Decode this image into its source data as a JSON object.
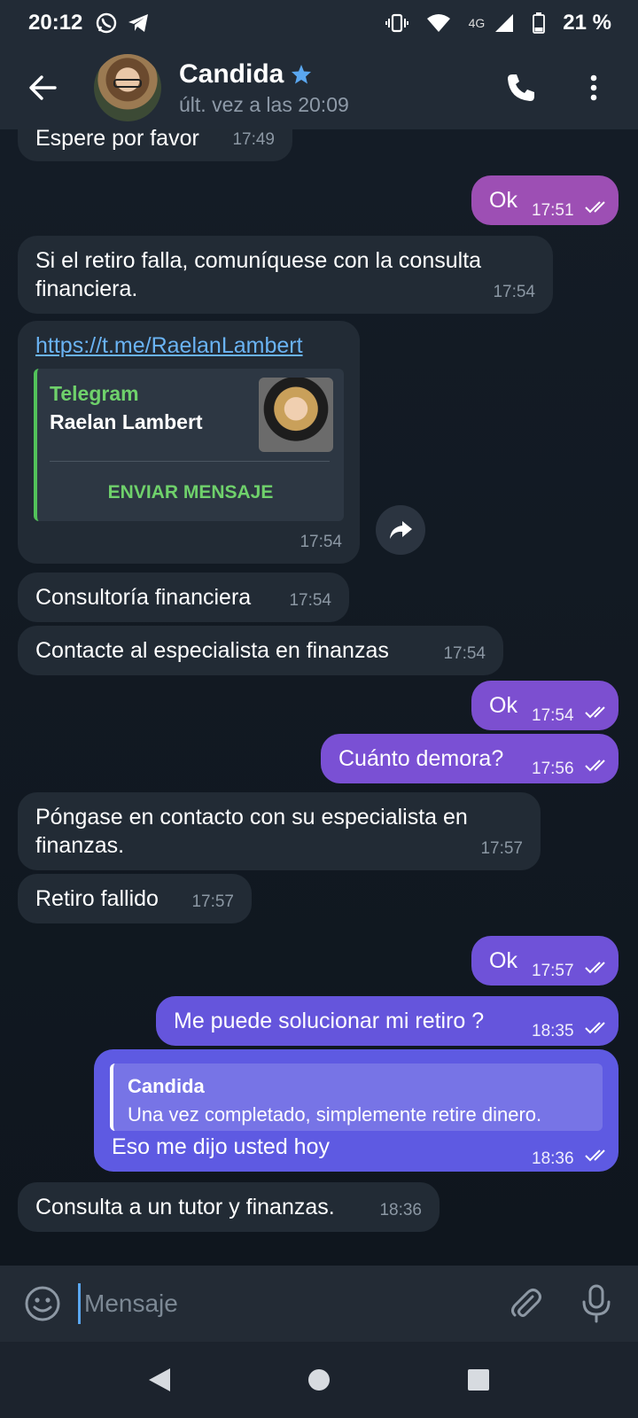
{
  "status_bar": {
    "time": "20:12",
    "network": "4G",
    "battery": "21 %"
  },
  "header": {
    "contact_name": "Candida",
    "last_seen": "últ. vez a las 20:09",
    "verified_icon": "star-icon"
  },
  "messages": [
    {
      "dir": "in",
      "text": "Espere por favor",
      "time": "17:49"
    },
    {
      "dir": "out",
      "text": "Ok",
      "time": "17:51"
    },
    {
      "dir": "in",
      "text": "Si el retiro falla, comuníquese con la consulta financiera.",
      "time": "17:54"
    },
    {
      "dir": "in",
      "type": "link",
      "text": "https://t.me/RaelanLambert",
      "time": "17:54",
      "preview": {
        "site": "Telegram",
        "title": "Raelan Lambert",
        "button": "ENVIAR MENSAJE"
      }
    },
    {
      "dir": "in",
      "text": "Consultoría financiera",
      "time": "17:54"
    },
    {
      "dir": "in",
      "text": "Contacte al especialista en finanzas",
      "time": "17:54"
    },
    {
      "dir": "out",
      "text": "Ok",
      "time": "17:54"
    },
    {
      "dir": "out",
      "text": "Cuánto demora?",
      "time": "17:56"
    },
    {
      "dir": "in",
      "text": "Póngase en contacto con su especialista en finanzas.",
      "time": "17:57"
    },
    {
      "dir": "in",
      "text": "Retiro fallido",
      "time": "17:57"
    },
    {
      "dir": "out",
      "text": "Ok",
      "time": "17:57"
    },
    {
      "dir": "out",
      "text": "Me puede solucionar mi retiro ?",
      "time": "18:35"
    },
    {
      "dir": "out",
      "type": "reply",
      "text": "Eso me dijo usted hoy",
      "time": "18:36",
      "reply": {
        "name": "Candida",
        "text": "Una vez completado, simplemente retire dinero."
      }
    },
    {
      "dir": "in",
      "text": "Consulta a un tutor y finanzas.",
      "time": "18:36"
    }
  ],
  "input": {
    "placeholder": "Mensaje"
  },
  "colors": {
    "accent": "#5aa7f0",
    "incoming_bubble": "#222b35",
    "outgoing_top": "#9b4fb5",
    "outgoing_bottom": "#5b5fe6",
    "link_preview_accent": "#52c25a"
  }
}
